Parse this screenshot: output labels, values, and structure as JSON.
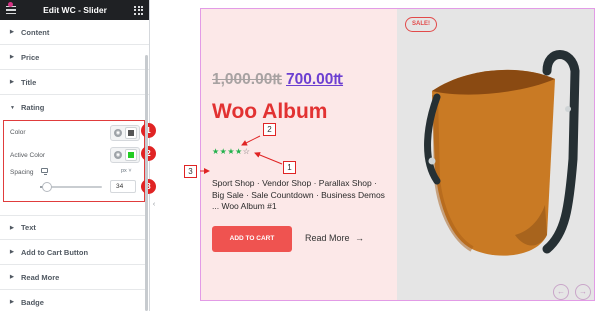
{
  "editor": {
    "title": "Edit WC - Slider",
    "sections": {
      "content": "Content",
      "price": "Price",
      "title": "Title",
      "rating": "Rating",
      "text": "Text",
      "add_to_cart": "Add to Cart Button",
      "read_more": "Read More",
      "badge": "Badge"
    },
    "rating_controls": {
      "color_label": "Color",
      "color_value": "#555555",
      "active_color_label": "Active Color",
      "active_color_value": "#22cc22",
      "spacing_label": "Spacing",
      "spacing_unit": "px ˅",
      "spacing_value": "34",
      "spacing_fraction": 0.05
    },
    "callout_numbers": [
      "1",
      "2",
      "3"
    ],
    "collapse_glyph": "‹"
  },
  "preview": {
    "sale_badge": "SALE!",
    "old_price": "1,000.00₶",
    "new_price": "700.00₶",
    "product_title": "Woo Album",
    "rating": {
      "filled": 4,
      "total": 5,
      "on_glyph": "★★★★",
      "off_glyph": "☆"
    },
    "categories": "Sport Shop · Vendor Shop · Parallax Shop · Big Sale · Sale Countdown · Business Demos ... Woo Album #1",
    "add_to_cart": "ADD TO CART",
    "read_more": "Read More",
    "read_more_icon": "→",
    "prev_icon": "←",
    "next_icon": "→",
    "callout_numbers": [
      "2",
      "1",
      "3"
    ]
  },
  "colors": {
    "annotation_red": "#e02424",
    "title_red": "#e23232",
    "price_purple": "#6c3fd1",
    "button_red": "#ef5350"
  }
}
